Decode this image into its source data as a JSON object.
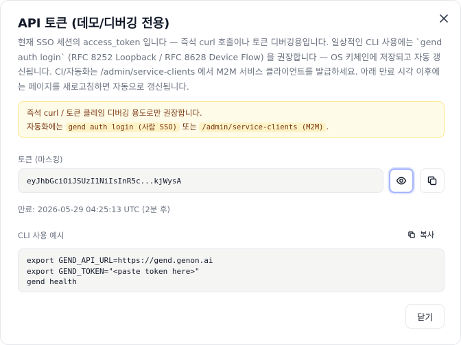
{
  "dialog": {
    "title": "API 토큰 (데모/디버깅 전용)",
    "close_icon": "close-icon",
    "description": "현재 SSO 세션의 access_token 입니다 — 즉석 curl 호출이나 토큰 디버깅용입니다. 일상적인 CLI 사용에는 `gend auth login` (RFC 8252 Loopback / RFC 8628 Device Flow) 을 권장합니다 — OS 키체인에 저장되고 자동 갱신됩니다. CI/자동화는 /admin/service-clients 에서 M2M 서비스 클라이언트를 발급하세요. 아래 만료 시각 이후에는 페이지를 새로고침하면 자동으로 갱신됩니다."
  },
  "notice": {
    "line1": "즉석 curl / 토큰 클레임 디버깅 용도로만 권장합니다.",
    "line2_prefix": "자동화에는",
    "code1": "gend auth login (사람 SSO)",
    "line2_mid": "또는",
    "code2": "/admin/service-clients (M2M)",
    "line2_suffix": "."
  },
  "token": {
    "label": "토큰 (마스킹)",
    "value": "eyJhbGciOiJSUzI1NiIsInR5c...kjWysA",
    "reveal_icon": "eye-icon",
    "copy_icon": "copy-icon",
    "expiry": "만료: 2026-05-29 04:25:13 UTC (2분 후)"
  },
  "cli": {
    "label": "CLI 사용 예시",
    "copy_label": "복사",
    "code": "export GEND_API_URL=https://gend.genon.ai\nexport GEND_TOKEN=\"<paste token here>\"\ngend health"
  },
  "footer": {
    "close_label": "닫기"
  }
}
